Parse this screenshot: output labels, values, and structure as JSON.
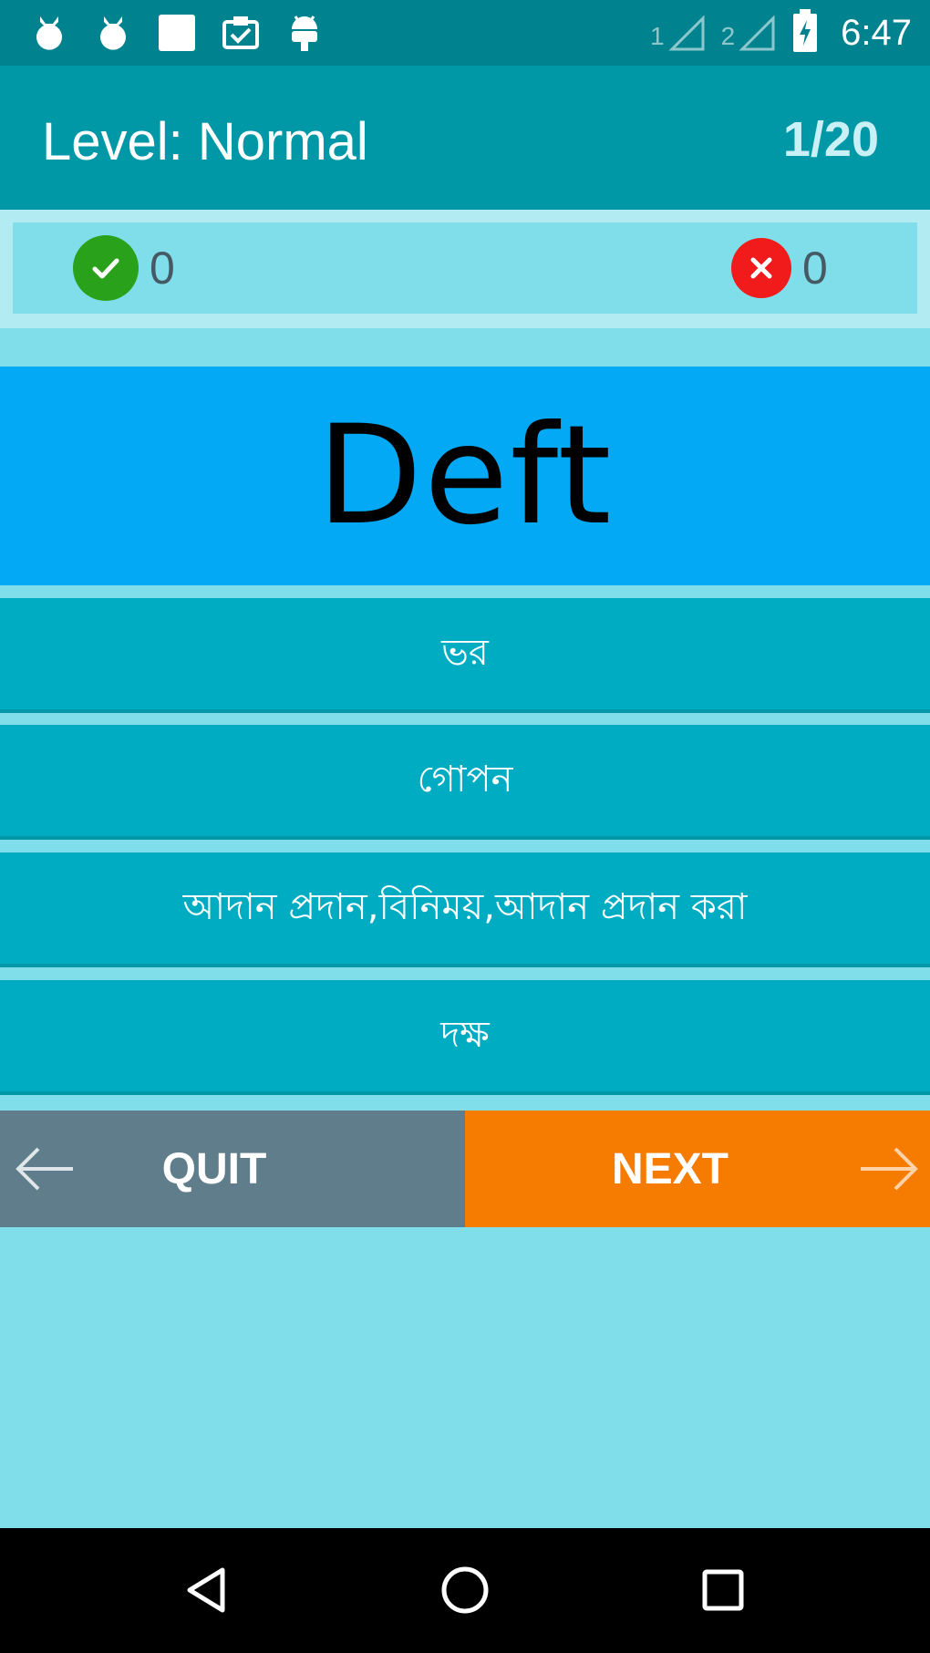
{
  "status_bar": {
    "icons": [
      "notification-icon-1",
      "notification-icon-2",
      "image-icon",
      "clipboard-check-icon",
      "android-icon"
    ],
    "sim1": "1",
    "sim2": "2",
    "time": "6:47"
  },
  "header": {
    "level_label": "Level: Normal",
    "progress": "1/20"
  },
  "score": {
    "correct": "0",
    "wrong": "0"
  },
  "question": {
    "word": "Deft"
  },
  "options": [
    {
      "label": "ভর"
    },
    {
      "label": "গোপন"
    },
    {
      "label": "আদান প্রদান,বিনিময়,আদান প্রদান করা"
    },
    {
      "label": "দক্ষ"
    }
  ],
  "buttons": {
    "quit": "QUIT",
    "next": "NEXT"
  },
  "colors": {
    "status_bar": "#00838f",
    "app_bar": "#0097a7",
    "background": "#80deea",
    "word_card": "#03a9f4",
    "option": "#00acc1",
    "quit": "#607d8b",
    "next": "#f57c00",
    "correct": "#2aa11a",
    "wrong": "#f21b1b"
  }
}
